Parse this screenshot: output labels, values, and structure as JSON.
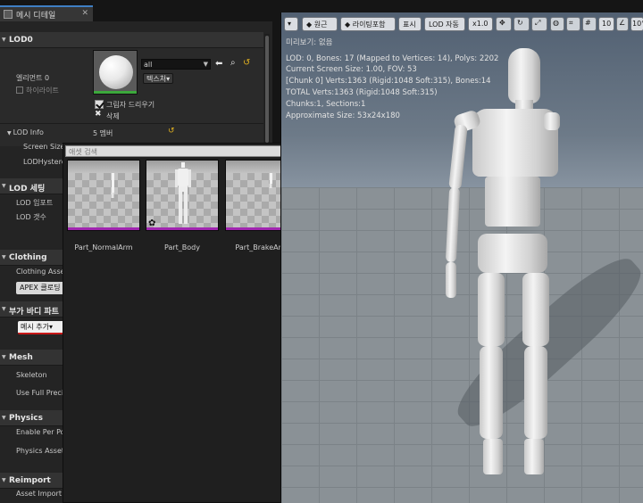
{
  "tab": {
    "title": "메시 디테일",
    "close": "✕"
  },
  "lod0": {
    "header": "LOD0",
    "element_label": "엘리먼트 0",
    "highlight_label": "하이라이트",
    "material_value": "all",
    "texture_button": "텍스처▾",
    "cast_shadow_label": "그림자 드리우기",
    "delete_label": "삭제",
    "lod_info_label": "LOD Info",
    "member_count": "5 멤버",
    "screen_size_label": "Screen Size",
    "lod_hysteresis_label": "LODHysteresis"
  },
  "lod_settings": {
    "header": "LOD 세팅",
    "import_label": "LOD 임포트",
    "count_label": "LOD 갯수"
  },
  "clothing": {
    "header": "Clothing",
    "assets_label": "Clothing Assets",
    "apex_button": "APEX 클로딩"
  },
  "extra_body": {
    "header": "부가 바디 파트",
    "add_mesh_button": "메시 추가▾"
  },
  "mesh": {
    "header": "Mesh",
    "skeleton_label": "Skeleton",
    "use_full_precision_label": "Use Full Precis"
  },
  "physics": {
    "header": "Physics",
    "enable_per_poly_label": "Enable Per Pol",
    "physics_asset_label": "Physics Asset"
  },
  "reimport": {
    "header": "Reimport",
    "asset_import_label": "Asset Import D"
  },
  "picker": {
    "search_placeholder": "애셋 검색",
    "assets": [
      {
        "label": "Part_NormalArm"
      },
      {
        "label": "Part_Body"
      },
      {
        "label": "Part_BrakeArm"
      }
    ]
  },
  "viewport": {
    "toolbar": {
      "menu_arrow": "▾",
      "perspective": "원근",
      "lighting": "라이팅포함",
      "show": "표시",
      "lod": "LOD 자동",
      "speed": "x1.0",
      "grid_value": "10",
      "angle_value": "10°"
    },
    "preview_label": "미리보기: 없음",
    "info_lines": [
      "LOD: 0, Bones: 17 (Mapped to Vertices: 14), Polys: 2202",
      "Current Screen Size: 1.00, FOV: 53",
      "[Chunk 0] Verts:1363 (Rigid:1048 Soft:315), Bones:14",
      "TOTAL Verts:1363 (Rigid:1048 Soft:315)",
      "Chunks:1, Sections:1",
      "Approximate Size: 53x24x180"
    ]
  },
  "colors": {
    "panel_bg": "#242424",
    "accent_tab": "#3f7fc4",
    "asset_bar": "#a126b0",
    "material_ok": "#3ca83c",
    "error_underline": "#c81818"
  }
}
